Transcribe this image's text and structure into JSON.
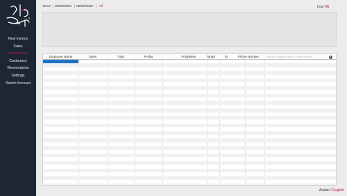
{
  "sidebar": {
    "logo_alt": "هناء سماء",
    "items": [
      {
        "label": "New invoice",
        "active": false
      },
      {
        "label": "Sales",
        "active": false
      },
      {
        "label": "Employees",
        "active": true
      },
      {
        "label": "Customers",
        "active": false
      },
      {
        "label": "Reservations",
        "active": false
      },
      {
        "label": "Settings",
        "active": false
      },
      {
        "label": "Switch Account",
        "active": false
      }
    ]
  },
  "filter": {
    "since_label": "Since",
    "separator": "|",
    "from_date": "00/00/0000",
    "to_date": "00/00/0000",
    "all_label": "All",
    "total_label": "Total",
    "total_value": "0$"
  },
  "table": {
    "columns": [
      "Employee Name",
      "Sales",
      "Total",
      "Profits",
      "Print",
      "Delete",
      "Target",
      "ID",
      "Phone Number"
    ],
    "search_placeholder": "Search Employee name / Phone number",
    "info_icon_glyph": "i",
    "row_count": 34,
    "selected_row": 0
  },
  "footer": {
    "lang_label": "Arabic",
    "lang_sep": "/",
    "lang_link": "English"
  },
  "colors": {
    "sidebar_bg": "#1c2733",
    "accent": "#c2185b",
    "selection": "#1e73c8"
  }
}
